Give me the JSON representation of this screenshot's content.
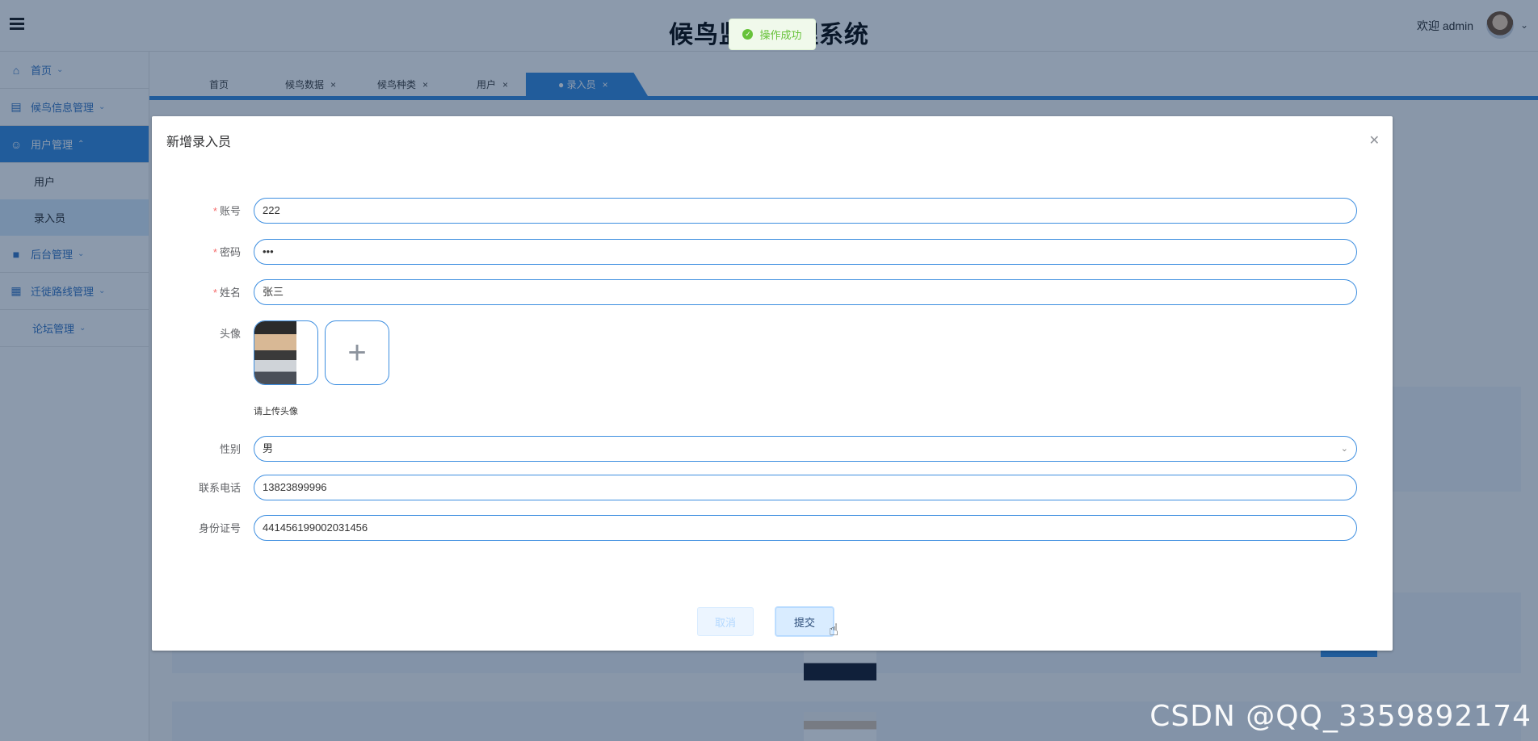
{
  "header": {
    "title": "候鸟监测管理系统",
    "welcome": "欢迎 admin"
  },
  "sidebar": {
    "items": [
      {
        "label": "首页"
      },
      {
        "label": "候鸟信息管理"
      },
      {
        "label": "用户管理"
      },
      {
        "label": "后台管理"
      },
      {
        "label": "迁徙路线管理"
      },
      {
        "label": "论坛管理"
      }
    ],
    "sub_items": [
      {
        "label": "用户"
      },
      {
        "label": "录入员"
      }
    ]
  },
  "tabs": [
    {
      "label": "首页"
    },
    {
      "label": "候鸟数据"
    },
    {
      "label": "候鸟种类"
    },
    {
      "label": "用户"
    },
    {
      "label": "● 录入员"
    }
  ],
  "toast": {
    "message": "操作成功"
  },
  "dialog": {
    "title": "新增录入员",
    "fields": {
      "account": {
        "label": "账号",
        "value": "222"
      },
      "password": {
        "label": "密码",
        "value": "•••"
      },
      "name": {
        "label": "姓名",
        "value": "张三"
      },
      "avatar": {
        "label": "头像",
        "hint": "请上传头像"
      },
      "gender": {
        "label": "性别",
        "value": "男"
      },
      "phone": {
        "label": "联系电话",
        "value": "13823899996"
      },
      "id_number": {
        "label": "身份证号",
        "value": "441456199002031456"
      }
    },
    "buttons": {
      "cancel": "取消",
      "submit": "提交"
    }
  },
  "watermark": "CSDN @QQ_3359892174"
}
